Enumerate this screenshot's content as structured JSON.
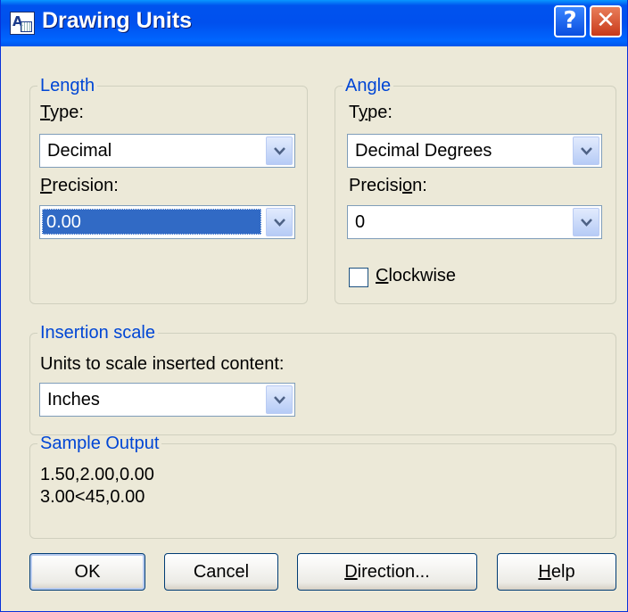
{
  "window": {
    "title": "Drawing Units",
    "help_glyph": "?",
    "close_glyph": "✕"
  },
  "length": {
    "legend": "Length",
    "type_label": {
      "pre": "",
      "u": "T",
      "post": "ype:"
    },
    "type_value": "Decimal",
    "precision_label": {
      "pre": "",
      "u": "P",
      "post": "recision:"
    },
    "precision_value": "0.00"
  },
  "angle": {
    "legend": "Angle",
    "type_label": {
      "pre": "T",
      "u": "y",
      "post": "pe:"
    },
    "type_value": "Decimal Degrees",
    "precision_label": {
      "pre": "Precisi",
      "u": "o",
      "post": "n:"
    },
    "precision_value": "0",
    "clockwise_label": {
      "pre": "",
      "u": "C",
      "post": "lockwise"
    },
    "clockwise_checked": false
  },
  "insertion": {
    "legend": "Insertion scale",
    "units_label": "Units to scale inserted content:",
    "units_value": "Inches"
  },
  "sample": {
    "legend": "Sample Output",
    "line1": "1.50,2.00,0.00",
    "line2": "3.00<45,0.00"
  },
  "buttons": {
    "ok": "OK",
    "cancel": "Cancel",
    "direction": {
      "pre": "",
      "u": "D",
      "post": "irection..."
    },
    "help": {
      "pre": "",
      "u": "H",
      "post": "elp"
    }
  },
  "colors": {
    "title_bar": "#0055ea",
    "group_legend": "#0046d5",
    "selection": "#316ac5",
    "dialog_bg": "#ece9d8"
  }
}
